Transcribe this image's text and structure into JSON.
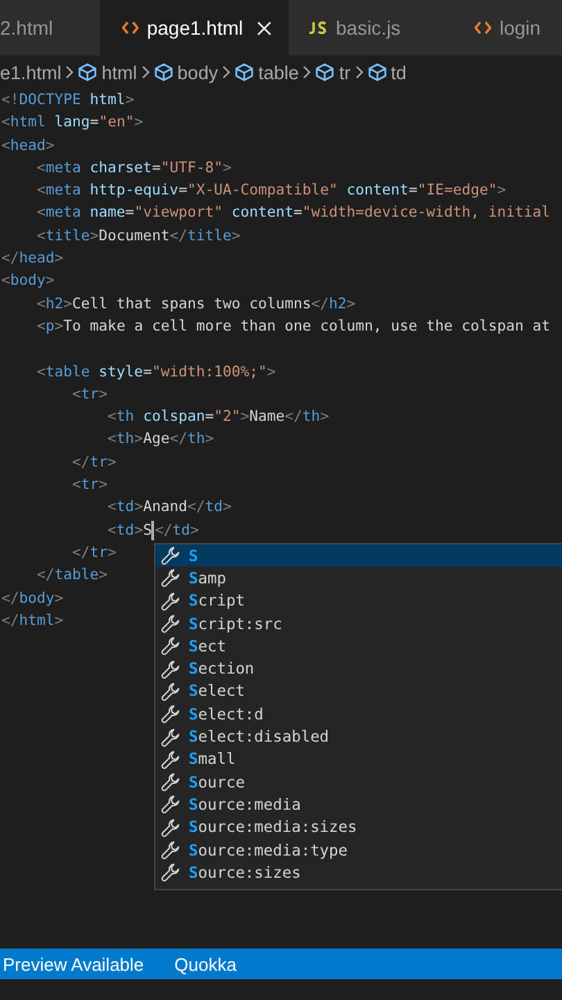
{
  "tabs": [
    {
      "label": "2.html",
      "kind": "html",
      "selected": false
    },
    {
      "label": "page1.html",
      "kind": "html",
      "selected": true
    },
    {
      "label": "basic.js",
      "kind": "js",
      "selected": false
    },
    {
      "label": "login",
      "kind": "html",
      "selected": false
    }
  ],
  "breadcrumb": [
    {
      "label": "e1.html",
      "kind": "file"
    },
    {
      "label": "html",
      "kind": "element"
    },
    {
      "label": "body",
      "kind": "element"
    },
    {
      "label": "table",
      "kind": "element"
    },
    {
      "label": "tr",
      "kind": "element"
    },
    {
      "label": "td",
      "kind": "element"
    }
  ],
  "code_lines": [
    {
      "tokens": [
        {
          "kind": "p",
          "text": "<!"
        },
        {
          "kind": "tag",
          "text": "DOCTYPE"
        },
        {
          "kind": "attr",
          "text": " html"
        },
        {
          "kind": "p",
          "text": ">"
        }
      ]
    },
    {
      "tokens": [
        {
          "kind": "p",
          "text": "<"
        },
        {
          "kind": "tag",
          "text": "html"
        },
        {
          "kind": "attr",
          "text": " lang"
        },
        {
          "kind": "t",
          "text": "="
        },
        {
          "kind": "str",
          "text": "\"en\""
        },
        {
          "kind": "p",
          "text": ">"
        }
      ]
    },
    {
      "tokens": [
        {
          "kind": "p",
          "text": "<"
        },
        {
          "kind": "tag",
          "text": "head"
        },
        {
          "kind": "p",
          "text": ">"
        }
      ]
    },
    {
      "tokens": [
        {
          "kind": "p",
          "text": "    <"
        },
        {
          "kind": "tag",
          "text": "meta"
        },
        {
          "kind": "attr",
          "text": " charset"
        },
        {
          "kind": "t",
          "text": "="
        },
        {
          "kind": "str",
          "text": "\"UTF-8\""
        },
        {
          "kind": "p",
          "text": ">"
        }
      ]
    },
    {
      "tokens": [
        {
          "kind": "p",
          "text": "    <"
        },
        {
          "kind": "tag",
          "text": "meta"
        },
        {
          "kind": "attr",
          "text": " http-equiv"
        },
        {
          "kind": "t",
          "text": "="
        },
        {
          "kind": "str",
          "text": "\"X-UA-Compatible\""
        },
        {
          "kind": "attr",
          "text": " content"
        },
        {
          "kind": "t",
          "text": "="
        },
        {
          "kind": "str",
          "text": "\"IE=edge\""
        },
        {
          "kind": "p",
          "text": ">"
        }
      ]
    },
    {
      "tokens": [
        {
          "kind": "p",
          "text": "    <"
        },
        {
          "kind": "tag",
          "text": "meta"
        },
        {
          "kind": "attr",
          "text": " name"
        },
        {
          "kind": "t",
          "text": "="
        },
        {
          "kind": "str",
          "text": "\"viewport\""
        },
        {
          "kind": "attr",
          "text": " content"
        },
        {
          "kind": "t",
          "text": "="
        },
        {
          "kind": "str",
          "text": "\"width=device-width, initial"
        }
      ]
    },
    {
      "tokens": [
        {
          "kind": "p",
          "text": "    <"
        },
        {
          "kind": "tag",
          "text": "title"
        },
        {
          "kind": "p",
          "text": ">"
        },
        {
          "kind": "t",
          "text": "Document"
        },
        {
          "kind": "p",
          "text": "</"
        },
        {
          "kind": "tag",
          "text": "title"
        },
        {
          "kind": "p",
          "text": ">"
        }
      ]
    },
    {
      "tokens": [
        {
          "kind": "p",
          "text": "</"
        },
        {
          "kind": "tag",
          "text": "head"
        },
        {
          "kind": "p",
          "text": ">"
        }
      ]
    },
    {
      "tokens": [
        {
          "kind": "p",
          "text": "<"
        },
        {
          "kind": "tag",
          "text": "body"
        },
        {
          "kind": "p",
          "text": ">"
        }
      ]
    },
    {
      "tokens": [
        {
          "kind": "p",
          "text": "    <"
        },
        {
          "kind": "tag",
          "text": "h2"
        },
        {
          "kind": "p",
          "text": ">"
        },
        {
          "kind": "t",
          "text": "Cell that spans two columns"
        },
        {
          "kind": "p",
          "text": "</"
        },
        {
          "kind": "tag",
          "text": "h2"
        },
        {
          "kind": "p",
          "text": ">"
        }
      ]
    },
    {
      "tokens": [
        {
          "kind": "p",
          "text": "    <"
        },
        {
          "kind": "tag",
          "text": "p"
        },
        {
          "kind": "p",
          "text": ">"
        },
        {
          "kind": "t",
          "text": "To make a cell more than one column, use the colspan at"
        }
      ]
    },
    {
      "kind": "blank"
    },
    {
      "tokens": [
        {
          "kind": "p",
          "text": "    <"
        },
        {
          "kind": "tag",
          "text": "table"
        },
        {
          "kind": "attr",
          "text": " style"
        },
        {
          "kind": "t",
          "text": "="
        },
        {
          "kind": "str",
          "text": "\"width:100%;\""
        },
        {
          "kind": "p",
          "text": ">"
        }
      ]
    },
    {
      "tokens": [
        {
          "kind": "p",
          "text": "        <"
        },
        {
          "kind": "tag",
          "text": "tr"
        },
        {
          "kind": "p",
          "text": ">"
        }
      ]
    },
    {
      "tokens": [
        {
          "kind": "p",
          "text": "            <"
        },
        {
          "kind": "tag",
          "text": "th"
        },
        {
          "kind": "attr",
          "text": " colspan"
        },
        {
          "kind": "t",
          "text": "="
        },
        {
          "kind": "str",
          "text": "\"2\""
        },
        {
          "kind": "p",
          "text": ">"
        },
        {
          "kind": "t",
          "text": "Name"
        },
        {
          "kind": "p",
          "text": "</"
        },
        {
          "kind": "tag",
          "text": "th"
        },
        {
          "kind": "p",
          "text": ">"
        }
      ]
    },
    {
      "tokens": [
        {
          "kind": "p",
          "text": "            <"
        },
        {
          "kind": "tag",
          "text": "th"
        },
        {
          "kind": "p",
          "text": ">"
        },
        {
          "kind": "t",
          "text": "Age"
        },
        {
          "kind": "p",
          "text": "</"
        },
        {
          "kind": "tag",
          "text": "th"
        },
        {
          "kind": "p",
          "text": ">"
        }
      ]
    },
    {
      "tokens": [
        {
          "kind": "p",
          "text": "        </"
        },
        {
          "kind": "tag",
          "text": "tr"
        },
        {
          "kind": "p",
          "text": ">"
        }
      ]
    },
    {
      "tokens": [
        {
          "kind": "p",
          "text": "        <"
        },
        {
          "kind": "tag",
          "text": "tr"
        },
        {
          "kind": "p",
          "text": ">"
        }
      ]
    },
    {
      "tokens": [
        {
          "kind": "p",
          "text": "            <"
        },
        {
          "kind": "tag",
          "text": "td"
        },
        {
          "kind": "p",
          "text": ">"
        },
        {
          "kind": "t",
          "text": "Anand"
        },
        {
          "kind": "p",
          "text": "</"
        },
        {
          "kind": "tag",
          "text": "td"
        },
        {
          "kind": "p",
          "text": ">"
        }
      ]
    },
    {
      "tokens": [
        {
          "kind": "p",
          "text": "            <"
        },
        {
          "kind": "tag",
          "text": "td"
        },
        {
          "kind": "p",
          "text": ">"
        },
        {
          "kind": "t",
          "text": "S"
        },
        {
          "kind": "cursor"
        },
        {
          "kind": "p",
          "text": "</"
        },
        {
          "kind": "tag",
          "text": "td"
        },
        {
          "kind": "p",
          "text": ">"
        }
      ]
    },
    {
      "tokens": [
        {
          "kind": "p",
          "text": "        </"
        },
        {
          "kind": "tag",
          "text": "tr"
        },
        {
          "kind": "p",
          "text": ">"
        }
      ]
    },
    {
      "tokens": [
        {
          "kind": "p",
          "text": "    </"
        },
        {
          "kind": "tag",
          "text": "table"
        },
        {
          "kind": "p",
          "text": ">"
        }
      ]
    },
    {
      "tokens": [
        {
          "kind": "p",
          "text": "</"
        },
        {
          "kind": "tag",
          "text": "body"
        },
        {
          "kind": "p",
          "text": ">"
        }
      ]
    },
    {
      "tokens": [
        {
          "kind": "p",
          "text": "</"
        },
        {
          "kind": "tag",
          "text": "html"
        },
        {
          "kind": "p",
          "text": ">"
        }
      ]
    }
  ],
  "suggestions": [
    {
      "match": "S",
      "selected": true
    },
    {
      "match": "S",
      "rest": "amp",
      "selected": false
    },
    {
      "match": "S",
      "rest": "cript",
      "selected": false
    },
    {
      "match": "S",
      "rest": "cript:src",
      "selected": false
    },
    {
      "match": "S",
      "rest": "ect",
      "selected": false
    },
    {
      "match": "S",
      "rest": "ection",
      "selected": false
    },
    {
      "match": "S",
      "rest": "elect",
      "selected": false
    },
    {
      "match": "S",
      "rest": "elect:d",
      "selected": false
    },
    {
      "match": "S",
      "rest": "elect:disabled",
      "selected": false
    },
    {
      "match": "S",
      "rest": "mall",
      "selected": false
    },
    {
      "match": "S",
      "rest": "ource",
      "selected": false
    },
    {
      "match": "S",
      "rest": "ource:media",
      "selected": false
    },
    {
      "match": "S",
      "rest": "ource:media:sizes",
      "selected": false
    },
    {
      "match": "S",
      "rest": "ource:media:type",
      "selected": false
    },
    {
      "match": "S",
      "rest": "ource:sizes",
      "selected": false
    }
  ],
  "status_bar": [
    "Preview Available",
    "Quokka"
  ]
}
